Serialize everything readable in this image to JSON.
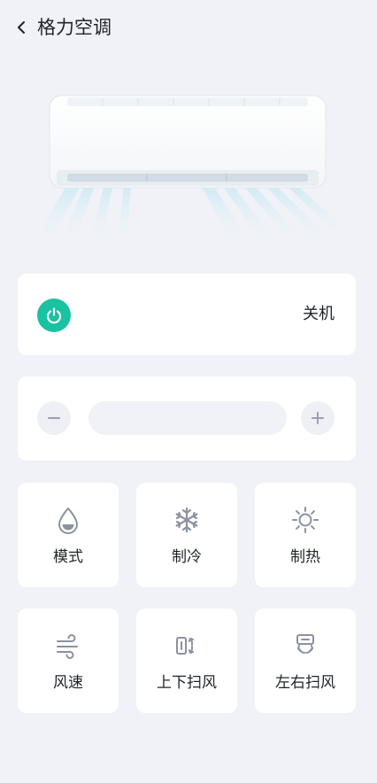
{
  "header": {
    "title": "格力空调",
    "back_icon": "chevron-left-icon"
  },
  "power": {
    "status": "关机",
    "accent": "#19c2a1"
  },
  "controls": [
    {
      "label": "模式",
      "icon": "drop-icon"
    },
    {
      "label": "制冷",
      "icon": "snowflake-icon"
    },
    {
      "label": "制热",
      "icon": "sun-icon"
    },
    {
      "label": "风速",
      "icon": "wind-icon"
    },
    {
      "label": "上下扫风",
      "icon": "vertical-swing-icon"
    },
    {
      "label": "左右扫风",
      "icon": "horizontal-swing-icon"
    }
  ]
}
